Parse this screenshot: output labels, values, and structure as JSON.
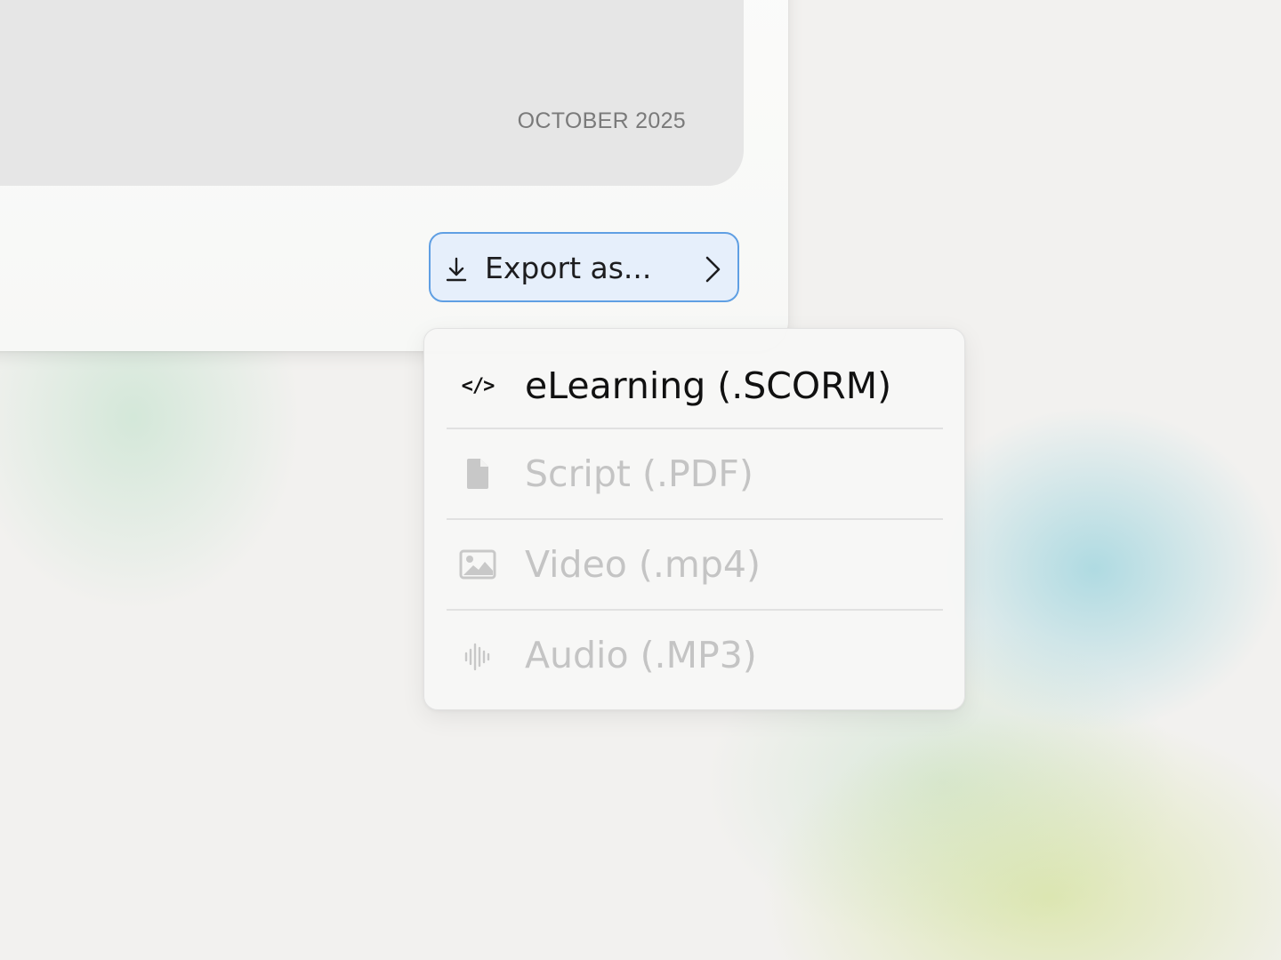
{
  "preview": {
    "date": "OCTOBER 2025"
  },
  "export_button": {
    "label": "Export as...",
    "icon": "download-icon",
    "trailing_icon": "chevron-right-icon",
    "border_color": "#5f9fe3",
    "background": "#e6effb"
  },
  "export_menu": {
    "items": [
      {
        "label": "eLearning (.SCORM)",
        "icon": "code-icon",
        "enabled": true
      },
      {
        "label": "Script (.PDF)",
        "icon": "document-icon",
        "enabled": false
      },
      {
        "label": "Video (.mp4)",
        "icon": "image-icon",
        "enabled": false
      },
      {
        "label": "Audio (.MP3)",
        "icon": "audio-waveform-icon",
        "enabled": false
      }
    ],
    "enabled_color": "#111111",
    "disabled_color": "#c4c4c4"
  }
}
